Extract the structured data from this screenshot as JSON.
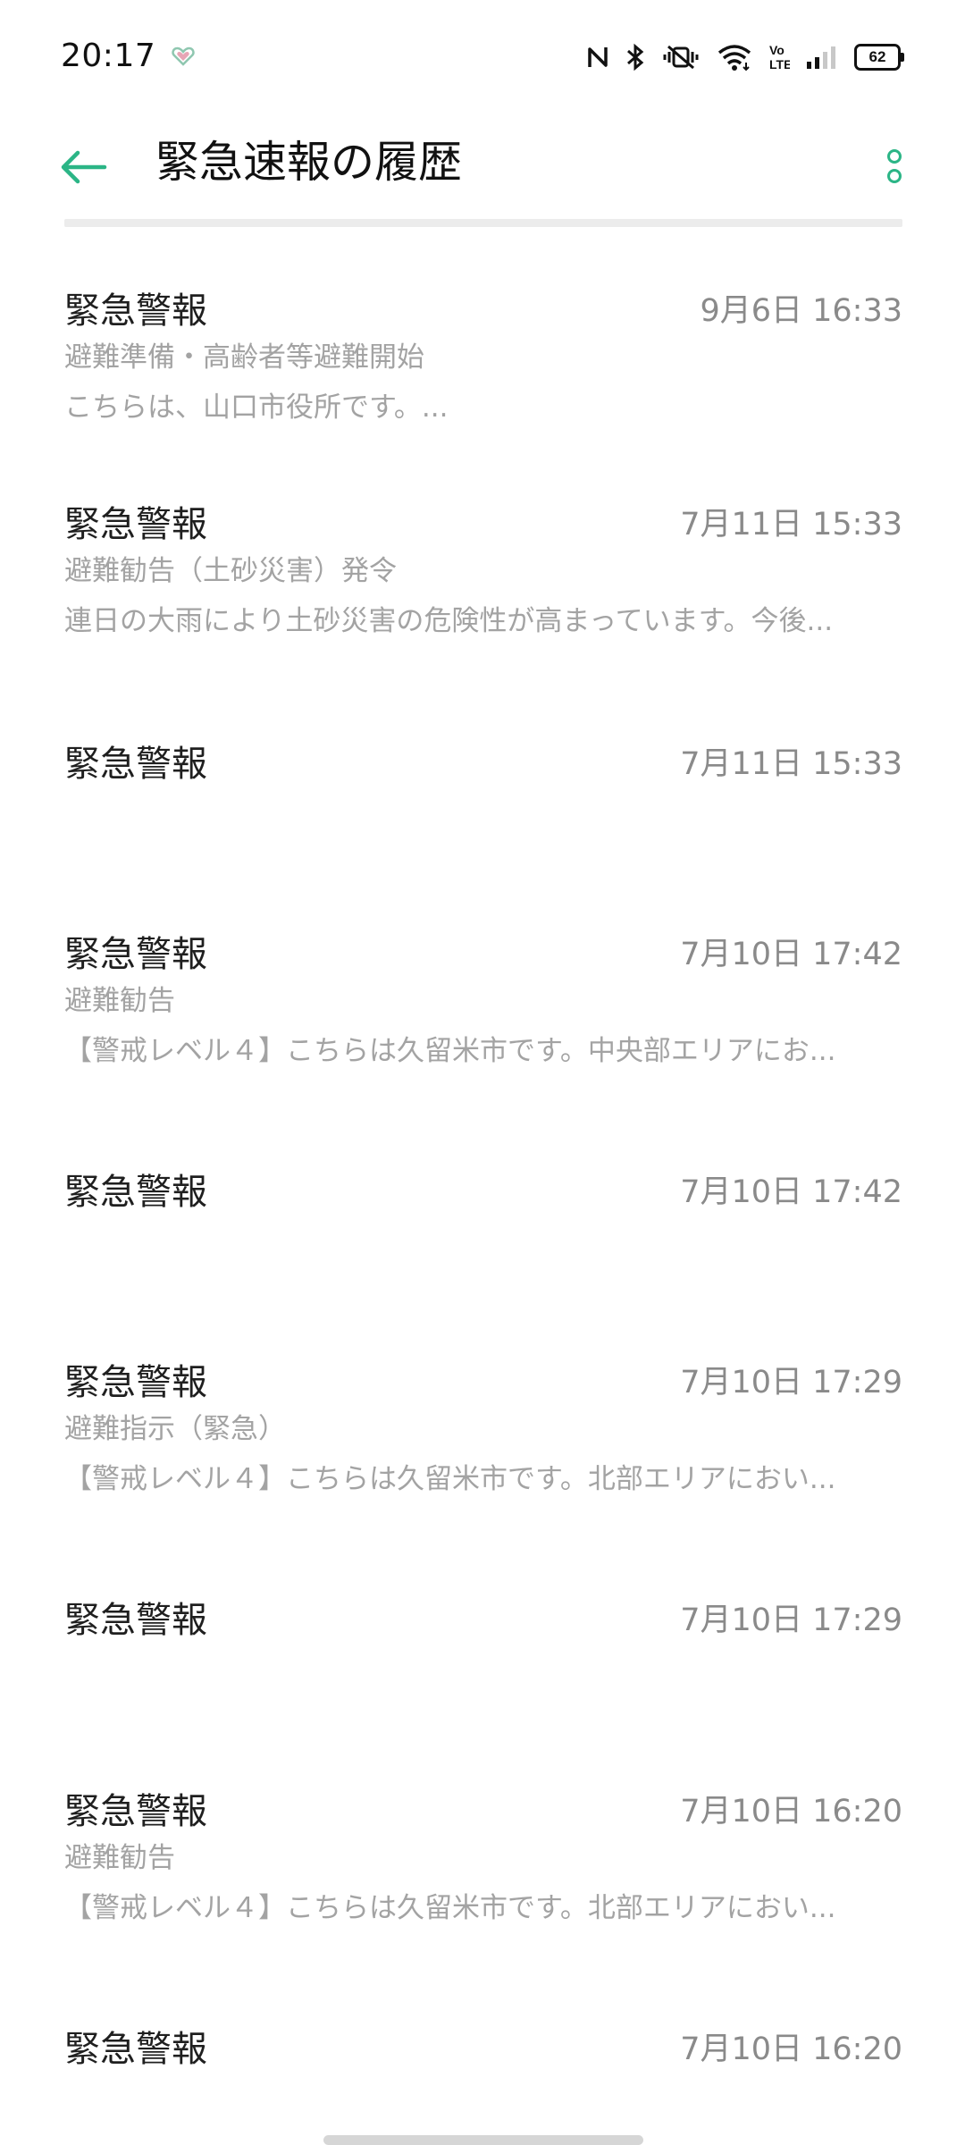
{
  "status_bar": {
    "time": "20:17",
    "battery": "62",
    "icons": [
      "heart-health-icon",
      "nfc-icon",
      "bluetooth-icon",
      "vibrate-icon",
      "wifi-icon",
      "volte-icon",
      "cellular-signal-icon",
      "battery-icon"
    ]
  },
  "header": {
    "title": "緊急速報の履歴",
    "accent_color": "#2bb586"
  },
  "alerts": [
    {
      "title": "緊急警報",
      "time": "9月6日 16:33",
      "subtitle": "避難準備・高齢者等避難開始",
      "body": "こちらは、山口市役所です。..."
    },
    {
      "title": "緊急警報",
      "time": "7月11日 15:33",
      "subtitle": "避難勧告（土砂災害）発令",
      "body": "連日の大雨により土砂災害の危険性が高まっています。今後..."
    },
    {
      "title": "緊急警報",
      "time": "7月11日 15:33",
      "subtitle": "",
      "body": ""
    },
    {
      "title": "緊急警報",
      "time": "7月10日 17:42",
      "subtitle": "避難勧告",
      "body": "【警戒レベル４】こちらは久留米市です。中央部エリアにお..."
    },
    {
      "title": "緊急警報",
      "time": "7月10日 17:42",
      "subtitle": "",
      "body": ""
    },
    {
      "title": "緊急警報",
      "time": "7月10日 17:29",
      "subtitle": "避難指示（緊急）",
      "body": "【警戒レベル４】こちらは久留米市です。北部エリアにおい..."
    },
    {
      "title": "緊急警報",
      "time": "7月10日 17:29",
      "subtitle": "",
      "body": ""
    },
    {
      "title": "緊急警報",
      "time": "7月10日 16:20",
      "subtitle": "避難勧告",
      "body": "【警戒レベル４】こちらは久留米市です。北部エリアにおい..."
    },
    {
      "title": "緊急警報",
      "time": "7月10日 16:20",
      "subtitle": "",
      "body": ""
    }
  ]
}
